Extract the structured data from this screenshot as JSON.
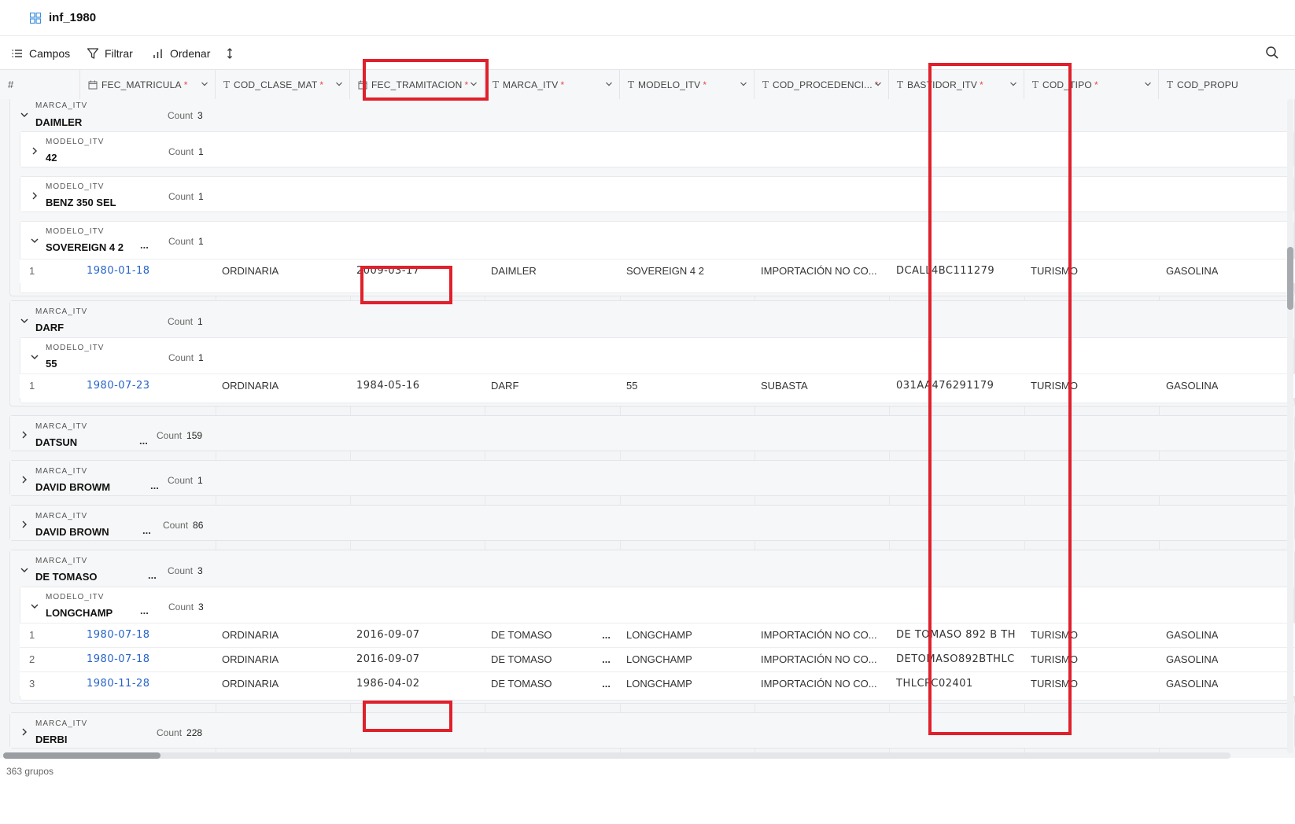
{
  "window": {
    "title": "inf_1980"
  },
  "toolbar": {
    "fields_label": "Campos",
    "filter_label": "Filtrar",
    "sort_label": "Ordenar"
  },
  "columns": {
    "index": "#",
    "c1": "FEC_MATRICULA",
    "c2": "COD_CLASE_MAT",
    "c3": "FEC_TRAMITACION",
    "c4": "MARCA_ITV",
    "c5": "MODELO_ITV",
    "c6": "COD_PROCEDENCI...",
    "c7": "BASTIDOR_ITV",
    "c8": "COD_TIPO",
    "c9": "COD_PROPU",
    "required_mark": "*"
  },
  "labels": {
    "marca": "MARCA_ITV",
    "modelo": "MODELO_ITV",
    "count": "Count",
    "ellipsis": "..."
  },
  "groups": {
    "daimler": {
      "value": "DAIMLER",
      "count": "3"
    },
    "m42": {
      "value": "42",
      "count": "1"
    },
    "benz": {
      "value": "BENZ 350 SEL",
      "count": "1"
    },
    "sovereign": {
      "value": "SOVEREIGN 4 2",
      "count": "1"
    },
    "darf": {
      "value": "DARF",
      "count": "1"
    },
    "m55": {
      "value": "55",
      "count": "1"
    },
    "datsun": {
      "value": "DATSUN",
      "count": "159"
    },
    "davidbrowm": {
      "value": "DAVID BROWM",
      "count": "1"
    },
    "davidbrown": {
      "value": "DAVID BROWN",
      "count": "86"
    },
    "detomaso": {
      "value": "DE TOMASO",
      "count": "3"
    },
    "longchamp": {
      "value": "LONGCHAMP",
      "count": "3"
    },
    "derbi": {
      "value": "DERBI",
      "count": "228"
    }
  },
  "rows": {
    "sov1": {
      "idx": "1",
      "fec_mat": "1980-01-18",
      "clase": "ORDINARIA",
      "fec_tram": "2009-03-17",
      "marca": "DAIMLER",
      "modelo": "SOVEREIGN 4 2",
      "proc": "IMPORTACIÓN NO CO...",
      "bastidor": "DCALL4BC111279",
      "tipo": "TURISMO",
      "propu": "GASOLINA"
    },
    "darf1": {
      "idx": "1",
      "fec_mat": "1980-07-23",
      "clase": "ORDINARIA",
      "fec_tram": "1984-05-16",
      "marca": "DARF",
      "modelo": "55",
      "proc": "SUBASTA",
      "bastidor": "031AA476291179",
      "tipo": "TURISMO",
      "propu": "GASOLINA"
    },
    "dt1": {
      "idx": "1",
      "fec_mat": "1980-07-18",
      "clase": "ORDINARIA",
      "fec_tram": "2016-09-07",
      "marca": "DE TOMASO",
      "modelo": "LONGCHAMP",
      "proc": "IMPORTACIÓN NO CO...",
      "bastidor": "DE TOMASO 892 B TH...",
      "tipo": "TURISMO",
      "propu": "GASOLINA"
    },
    "dt2": {
      "idx": "2",
      "fec_mat": "1980-07-18",
      "clase": "ORDINARIA",
      "fec_tram": "2016-09-07",
      "marca": "DE TOMASO",
      "modelo": "LONGCHAMP",
      "proc": "IMPORTACIÓN NO CO...",
      "bastidor": "DETOMASO892BTHLC...",
      "tipo": "TURISMO",
      "propu": "GASOLINA"
    },
    "dt3": {
      "idx": "3",
      "fec_mat": "1980-11-28",
      "clase": "ORDINARIA",
      "fec_tram": "1986-04-02",
      "marca": "DE TOMASO",
      "modelo": "LONGCHAMP",
      "proc": "IMPORTACIÓN NO CO...",
      "bastidor": "THLCPC02401",
      "tipo": "TURISMO",
      "propu": "GASOLINA"
    }
  },
  "footer": {
    "groups_count": "363 grupos"
  },
  "colors": {
    "accent_link": "#2563c9",
    "highlight": "#e0202b",
    "required": "#e5484d"
  },
  "icons": [
    "grid-icon",
    "list-icon",
    "filter-icon",
    "bar-chart-icon",
    "sort-arrows-icon",
    "search-icon",
    "calendar-icon",
    "text-type-icon",
    "chevron-down-icon",
    "chevron-right-icon"
  ]
}
